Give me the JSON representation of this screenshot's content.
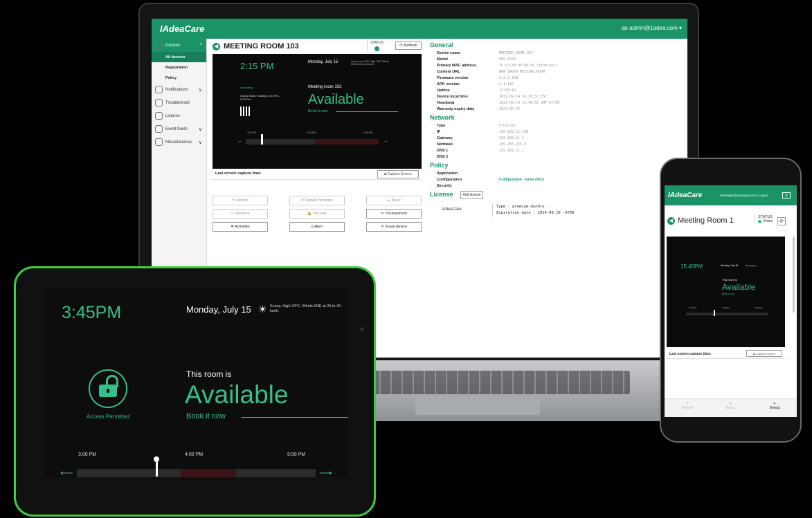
{
  "laptop": {
    "logo": "IAdeaCare",
    "user": "qa-admin@1adea.com ▾",
    "sidebar": [
      {
        "label": "Devices",
        "chev": "^"
      },
      {
        "label": "Notifications",
        "chev": "∨"
      },
      {
        "label": "Troubleshoot",
        "chev": ""
      },
      {
        "label": "License",
        "chev": ""
      },
      {
        "label": "Event feeds",
        "chev": "∨"
      },
      {
        "label": "Miscellaneous",
        "chev": "∨"
      }
    ],
    "sub_items": [
      "All devices",
      "Registration",
      "Policy"
    ],
    "room_title": "MEETING ROOM 103",
    "status_label": "STATUS",
    "refresh": "Refresh",
    "preview": {
      "time": "2:15 PM",
      "date": "Monday, July 15",
      "weather": "Sunny. Low 64°F. High 75°F. Winds ENE at 25 to 40 km/h.",
      "upcoming_label": "Upcoming",
      "upcoming_detail": "Global Sales Strategy 4:00 PM - 5:00 PM",
      "room_name": "Meeting room 102",
      "available": "Available",
      "book": "Book it now",
      "times": [
        "2:00 PM",
        "3:00 PM",
        "4:00 PM"
      ]
    },
    "capture_label": "Last screen capture time:",
    "capture_btn": "Capture Screen",
    "actions": [
      {
        "label": "Reboot",
        "icon": "⟳",
        "enabled": false
      },
      {
        "label": "Update firmware",
        "icon": "⬆",
        "enabled": false
      },
      {
        "label": "Basic",
        "icon": "☰",
        "enabled": false
      },
      {
        "label": "Network",
        "icon": "⚇",
        "enabled": false
      },
      {
        "label": "Security",
        "icon": "🔒",
        "enabled": false
      },
      {
        "label": "Troubleshoot",
        "icon": "✂",
        "enabled": true
      },
      {
        "label": "Activities",
        "icon": "✲",
        "enabled": true
      },
      {
        "label": "Alert",
        "icon": "◘",
        "enabled": true
      },
      {
        "label": "Share device",
        "icon": "⇗",
        "enabled": true
      }
    ],
    "general_title": "General",
    "general": [
      {
        "k": "Device name",
        "v": "MEETING ROOM 103"
      },
      {
        "k": "Model",
        "v": "XDS-1078"
      },
      {
        "k": "Primary MAC address",
        "v": "2C:C5:48:00:8D:6F (Ethernet)"
      },
      {
        "k": "Content URL",
        "v": "WWW.IADEA.MEETING.ROOM"
      },
      {
        "k": "Firmware version",
        "v": "2.2.2-108"
      },
      {
        "k": "APK version",
        "v": "1.1.116"
      },
      {
        "k": "Uptime",
        "v": "13:01:42"
      },
      {
        "k": "Device local time",
        "v": "2021-09-14 16:28:57 EST"
      },
      {
        "k": "Heartbeat",
        "v": "2021-09-14 14:48:51 GMT-07:00"
      },
      {
        "k": "Warranty expiry date",
        "v": "2024-05-27"
      }
    ],
    "network_title": "Network",
    "network": [
      {
        "k": "Type",
        "v": "Ethernet"
      },
      {
        "k": "IP",
        "v": "192.168.11.146"
      },
      {
        "k": "Gateway",
        "v": "192.168.11.1"
      },
      {
        "k": "Netmask",
        "v": "255.255.255.0"
      },
      {
        "k": "DNS 1",
        "v": "192.168.11.1"
      },
      {
        "k": "DNS 2",
        "v": ""
      }
    ],
    "policy_title": "Policy",
    "policy": [
      {
        "k": "Application",
        "v": ""
      },
      {
        "k": "Configuration",
        "v": "Configuration - Irvine office"
      },
      {
        "k": "Security",
        "v": ""
      }
    ],
    "license_title": "License",
    "add_license": "Add license",
    "license_name": "IAdeaCare",
    "license_type": "Type : premium-bundle",
    "license_exp": "Expiration date : 2024-06-10 -0700"
  },
  "tablet": {
    "time": "3:45PM",
    "date": "Monday, July 15",
    "weather": "Sunny. High 23°C. Winds ENE at 25 to 40 km/h.",
    "access": "Access Permitted",
    "room_is": "This room is",
    "available": "Available",
    "book": "Book it now",
    "times": [
      "3:00 PM",
      "4:00 PM",
      "5:00 PM"
    ]
  },
  "phone": {
    "logo": "IAdeaCare",
    "user": "itmanager@company.com | Logout",
    "title": "Meeting Room 1",
    "status_label": "STATUS",
    "status_value": "Online",
    "time": "15:45PM",
    "date": "Monday, July 15",
    "room_is": "This room is",
    "available": "Available",
    "book": "Book it now",
    "times": [
      "3:00 PM",
      "4:00 PM",
      "5:00 PM"
    ],
    "capture_label": "Last screen capture time:",
    "capture_btn": "Capture Screen",
    "tabs": [
      "Reboot",
      "Basic",
      "Debug"
    ]
  },
  "colors": {
    "accent": "#1a9466",
    "available_green": "#35c08a",
    "tablet_border": "#3ecf3e"
  }
}
